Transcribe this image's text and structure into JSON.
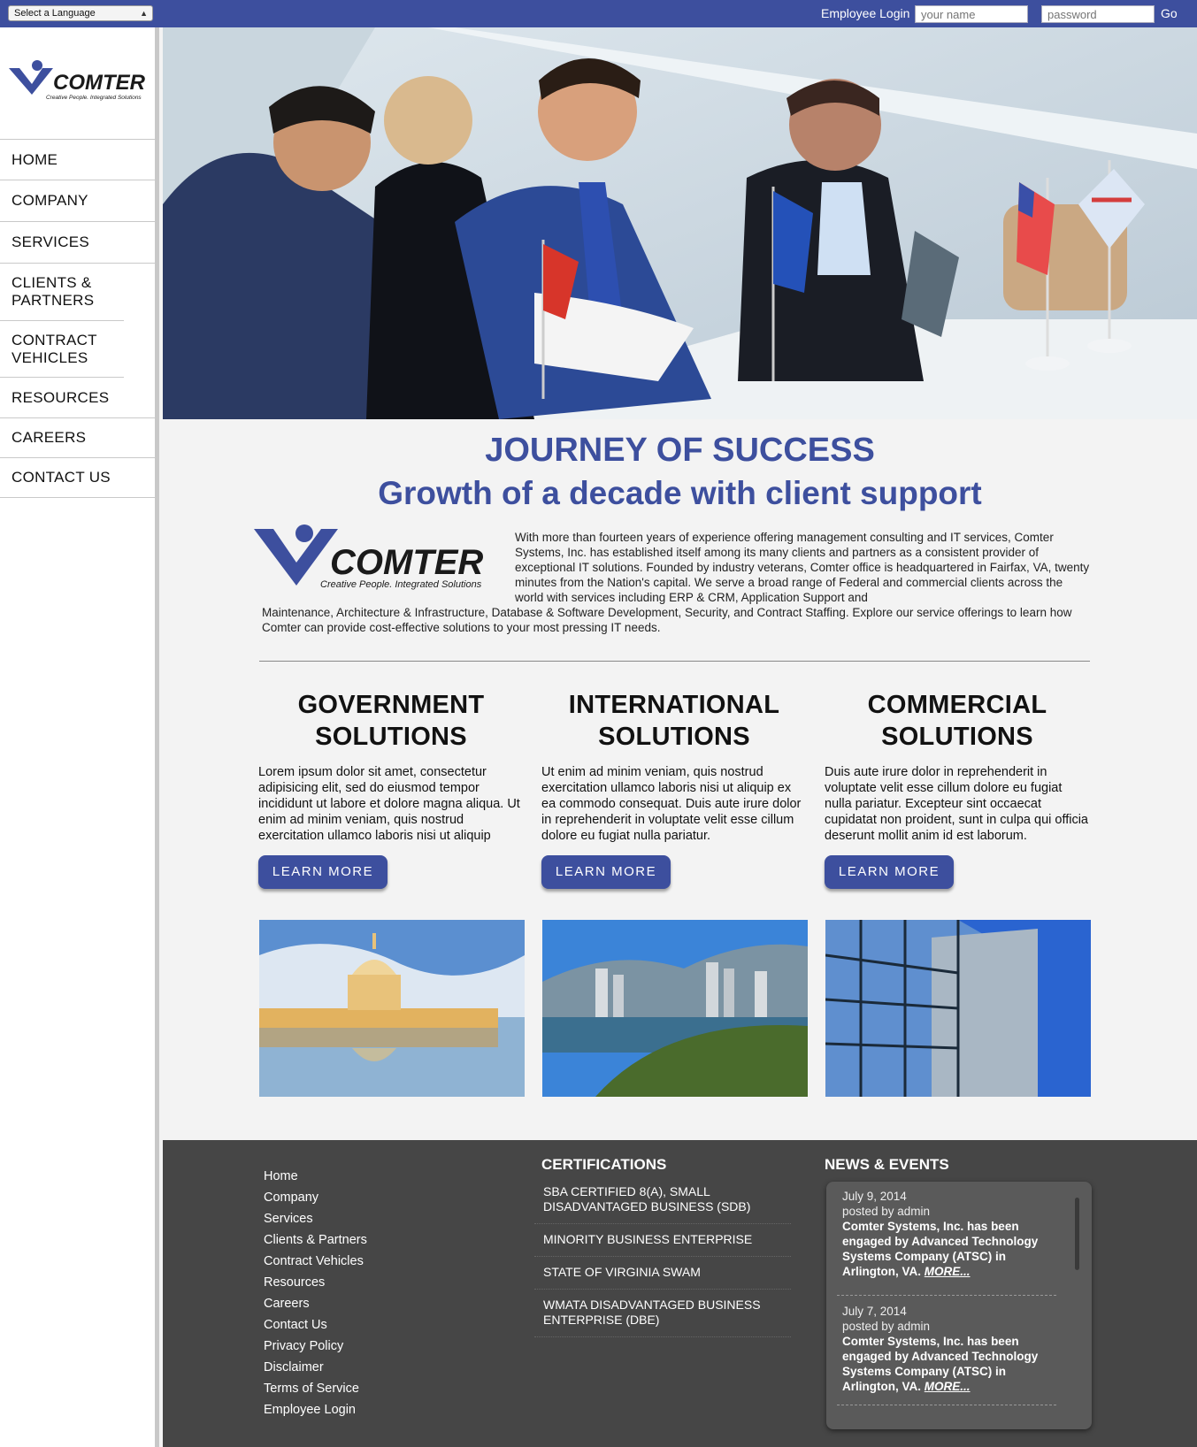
{
  "topbar": {
    "language_select": "Select a Language",
    "login_label": "Employee Login",
    "username_placeholder": "your name",
    "password_placeholder": "password",
    "go_label": "Go"
  },
  "brand": {
    "name": "COMTER",
    "tagline": "Creative People. Integrated Solutions",
    "color": "#3d4f9e"
  },
  "nav": [
    "HOME",
    "COMPANY",
    "SERVICES",
    "CLIENTS & PARTNERS",
    "CONTRACT VEHICLES",
    "RESOURCES",
    "CAREERS",
    "CONTACT US"
  ],
  "main": {
    "title": "JOURNEY OF SUCCESS",
    "subtitle": "Growth of a decade with client support",
    "intro_top": "With more than fourteen years of experience offering management consulting and IT services, Comter Systems, Inc. has established itself among its many clients and partners as a consistent provider of exceptional IT solutions. Founded by industry veterans, Comter office is headquartered in Fairfax, VA, twenty minutes from the Nation's capital. We serve a broad range of Federal and commercial clients across the world with services including ERP & CRM, Application Support and",
    "intro_bottom": "Maintenance, Architecture & Infrastructure, Database & Software Development, Security, and Contract Staffing. Explore our service offerings to learn how Comter can provide cost-effective solutions to your most pressing IT needs."
  },
  "solutions": [
    {
      "title": "GOVERNMENT SOLUTIONS",
      "text": "Lorem ipsum dolor sit amet, consectetur adipisicing elit, sed do eiusmod tempor incididunt ut labore et dolore magna aliqua. Ut enim ad minim veniam, quis nostrud exercitation ullamco laboris nisi ut aliquip",
      "button": "LEARN MORE"
    },
    {
      "title": "INTERNATIONAL SOLUTIONS",
      "text": "Ut enim ad minim veniam, quis nostrud exercitation ullamco laboris nisi ut aliquip ex ea commodo consequat. Duis aute irure dolor in reprehenderit in voluptate velit esse cillum dolore eu fugiat nulla pariatur.",
      "button": "LEARN MORE"
    },
    {
      "title": "COMMERCIAL SOLUTIONS",
      "text": "Duis aute irure dolor in reprehenderit in voluptate velit esse cillum dolore eu fugiat nulla pariatur. Excepteur sint occaecat cupidatat non proident, sunt in culpa qui officia deserunt mollit anim id est laborum.",
      "button": "LEARN MORE"
    }
  ],
  "footer": {
    "links": [
      "Home",
      "Company",
      "Services",
      "Clients & Partners",
      "Contract Vehicles",
      "Resources",
      "Careers",
      "Contact Us",
      "Privacy Policy",
      "Disclaimer",
      "Terms of Service",
      "Employee Login"
    ],
    "certifications_title": "CERTIFICATIONS",
    "certifications": [
      "SBA CERTIFIED 8(A), SMALL DISADVANTAGED BUSINESS (SDB)",
      "MINORITY BUSINESS ENTERPRISE",
      "STATE OF VIRGINIA SWAM",
      "WMATA DISADVANTAGED BUSINESS ENTERPRISE (DBE)"
    ],
    "news_title": "NEWS & EVENTS",
    "news": [
      {
        "date": "July 9, 2014",
        "by": "posted by admin",
        "text": "Comter Systems, Inc. has been engaged by Advanced Technology Systems Company (ATSC) in Arlington, VA.",
        "more": "MORE..."
      },
      {
        "date": "July 7, 2014",
        "by": "posted by admin",
        "text": "Comter Systems, Inc. has been engaged by Advanced Technology Systems Company (ATSC) in Arlington, VA.",
        "more": "MORE..."
      }
    ]
  }
}
